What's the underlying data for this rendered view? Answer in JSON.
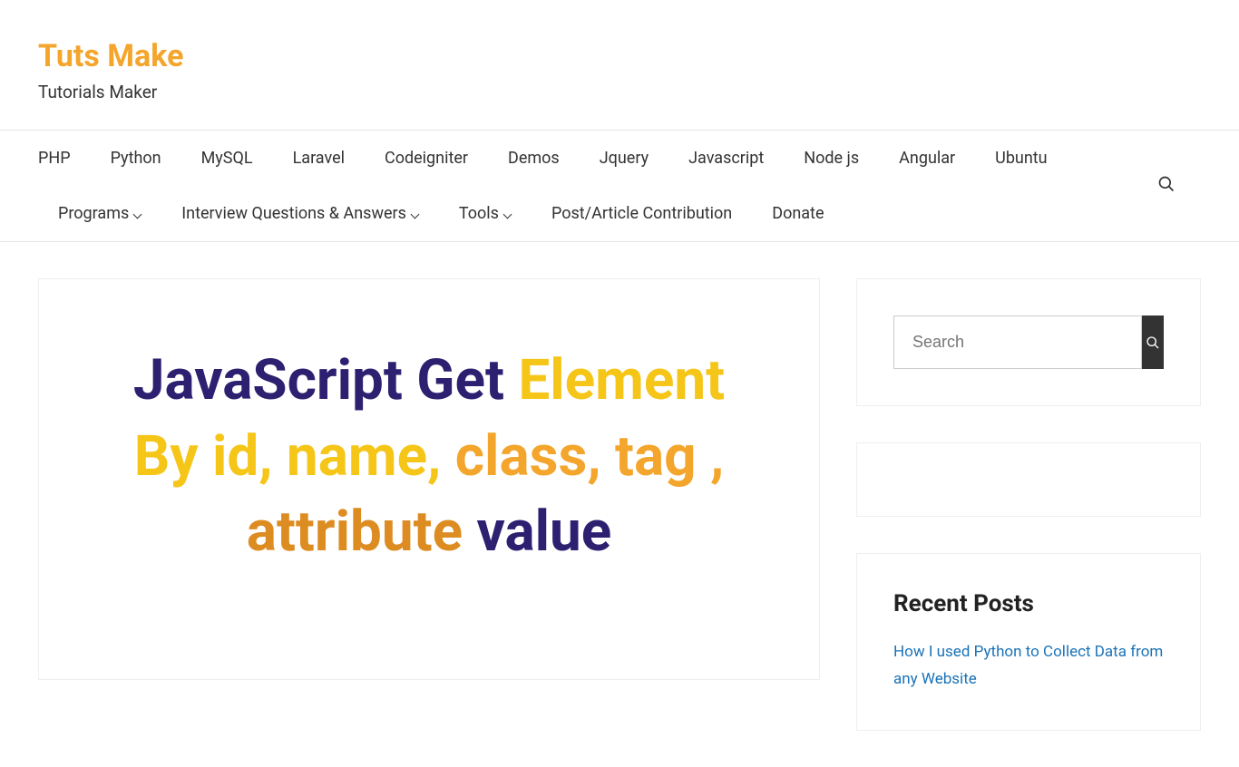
{
  "site": {
    "title": "Tuts Make",
    "tagline": "Tutorials Maker"
  },
  "nav": {
    "items": [
      {
        "label": "PHP",
        "has_submenu": false
      },
      {
        "label": "Python",
        "has_submenu": false
      },
      {
        "label": "MySQL",
        "has_submenu": false
      },
      {
        "label": "Laravel",
        "has_submenu": false
      },
      {
        "label": "Codeigniter",
        "has_submenu": false
      },
      {
        "label": "Demos",
        "has_submenu": false
      },
      {
        "label": "Jquery",
        "has_submenu": false
      },
      {
        "label": "Javascript",
        "has_submenu": false
      },
      {
        "label": "Node js",
        "has_submenu": false
      },
      {
        "label": "Angular",
        "has_submenu": false
      },
      {
        "label": "Ubuntu",
        "has_submenu": false
      },
      {
        "label": "Programs",
        "has_submenu": true
      },
      {
        "label": "Interview Questions & Answers",
        "has_submenu": true
      },
      {
        "label": "Tools",
        "has_submenu": true
      },
      {
        "label": "Post/Article Contribution",
        "has_submenu": false
      },
      {
        "label": "Donate",
        "has_submenu": false
      }
    ]
  },
  "article": {
    "hero_prefix": "JavaScript Get ",
    "hero_element": "Element",
    "hero_line2a": "By id, name, ",
    "hero_line2b": "class, tag ,",
    "hero_line3a": "attribute ",
    "hero_line3b": "value"
  },
  "sidebar": {
    "search_placeholder": "Search",
    "recent_title": "Recent Posts",
    "recent_items": [
      "How I used Python to Collect Data from any Website"
    ]
  }
}
